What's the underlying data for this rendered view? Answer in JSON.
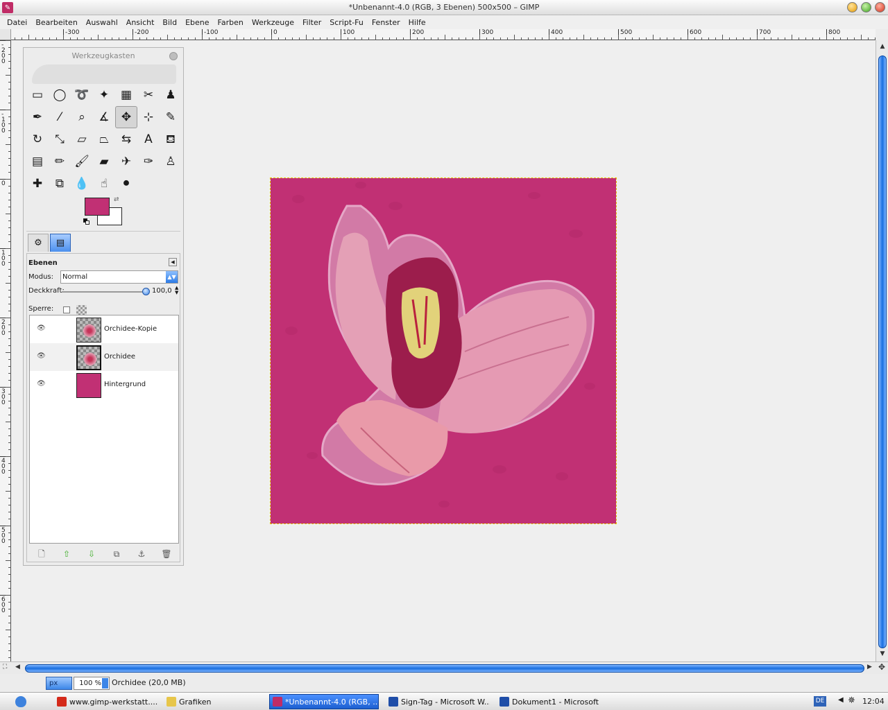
{
  "window": {
    "title": "*Unbenannt-4.0 (RGB, 3 Ebenen) 500x500 – GIMP"
  },
  "menu": [
    {
      "label": "Datei"
    },
    {
      "label": "Bearbeiten"
    },
    {
      "label": "Auswahl"
    },
    {
      "label": "Ansicht"
    },
    {
      "label": "Bild"
    },
    {
      "label": "Ebene"
    },
    {
      "label": "Farben"
    },
    {
      "label": "Werkzeuge"
    },
    {
      "label": "Filter"
    },
    {
      "label": "Script-Fu"
    },
    {
      "label": "Fenster"
    },
    {
      "label": "Hilfe"
    }
  ],
  "rulers": {
    "horizontal_labels": [
      "-300",
      "-200",
      "-100",
      "0",
      "100",
      "200",
      "300",
      "400",
      "500",
      "600",
      "700",
      "800"
    ],
    "vertical_labels": [
      "-200",
      "-100",
      "0",
      "100",
      "200",
      "300",
      "400",
      "500",
      "600"
    ]
  },
  "toolbox": {
    "title": "Werkzeugkasten",
    "foreground_color": "#c13074",
    "background_color": "#ffffff",
    "tools": [
      {
        "name": "rect-select",
        "glyph": "▭"
      },
      {
        "name": "ellipse-select",
        "glyph": "◯"
      },
      {
        "name": "lasso-select",
        "glyph": "➰"
      },
      {
        "name": "fuzzy-select",
        "glyph": "✦"
      },
      {
        "name": "select-by-color",
        "glyph": "▦"
      },
      {
        "name": "scissors-select",
        "glyph": "✂"
      },
      {
        "name": "foreground-select",
        "glyph": "♟"
      },
      {
        "name": "paths",
        "glyph": "✒"
      },
      {
        "name": "color-picker",
        "glyph": "⁄"
      },
      {
        "name": "zoom",
        "glyph": "⌕"
      },
      {
        "name": "measure",
        "glyph": "∡"
      },
      {
        "name": "move",
        "glyph": "✥",
        "selected": true
      },
      {
        "name": "align",
        "glyph": "⊹"
      },
      {
        "name": "crop",
        "glyph": "✎"
      },
      {
        "name": "rotate",
        "glyph": "↻"
      },
      {
        "name": "scale",
        "glyph": "⤡"
      },
      {
        "name": "shear",
        "glyph": "▱"
      },
      {
        "name": "perspective",
        "glyph": "⏢"
      },
      {
        "name": "flip",
        "glyph": "⇆"
      },
      {
        "name": "text",
        "glyph": "A"
      },
      {
        "name": "bucket-fill",
        "glyph": "⛾"
      },
      {
        "name": "blend",
        "glyph": "▤"
      },
      {
        "name": "pencil",
        "glyph": "✏"
      },
      {
        "name": "paintbrush",
        "glyph": "🖌"
      },
      {
        "name": "eraser",
        "glyph": "▰"
      },
      {
        "name": "airbrush",
        "glyph": "✈"
      },
      {
        "name": "ink",
        "glyph": "✑"
      },
      {
        "name": "clone",
        "glyph": "♙"
      },
      {
        "name": "heal",
        "glyph": "✚"
      },
      {
        "name": "perspective-clone",
        "glyph": "⧉"
      },
      {
        "name": "blur-sharpen",
        "glyph": "💧"
      },
      {
        "name": "smudge",
        "glyph": "☝"
      },
      {
        "name": "dodge-burn",
        "glyph": "⚫"
      }
    ]
  },
  "layers_panel": {
    "title": "Ebenen",
    "mode_label": "Modus:",
    "mode_value": "Normal",
    "opacity_label": "Deckkraft:",
    "opacity_value": "100,0",
    "opacity_fraction": 1.0,
    "lock_label": "Sperre:",
    "layers": [
      {
        "name": "Orchidee-Kopie",
        "visible": true,
        "type": "image"
      },
      {
        "name": "Orchidee",
        "visible": true,
        "type": "image",
        "active": true
      },
      {
        "name": "Hintergrund",
        "visible": true,
        "type": "fill",
        "color": "#c13074"
      }
    ]
  },
  "statusbar": {
    "unit": "px",
    "zoom": "100 %",
    "message": "Orchidee (20,0 MB)"
  },
  "taskbar": {
    "tasks": [
      {
        "label": "www.gimp-werkstatt....",
        "icon_color": "#d42a1a"
      },
      {
        "label": "Grafiken",
        "icon_color": "#e7c64a"
      },
      {
        "label": "*Unbenannt-4.0 (RGB, ...",
        "icon_color": "#c02c66",
        "active": true
      },
      {
        "label": "Sign-Tag - Microsoft W...",
        "icon_color": "#1f4ea8"
      },
      {
        "label": "Dokument1 - Microsoft ...",
        "icon_color": "#1f4ea8"
      }
    ],
    "language": "DE",
    "clock": "12:04"
  }
}
